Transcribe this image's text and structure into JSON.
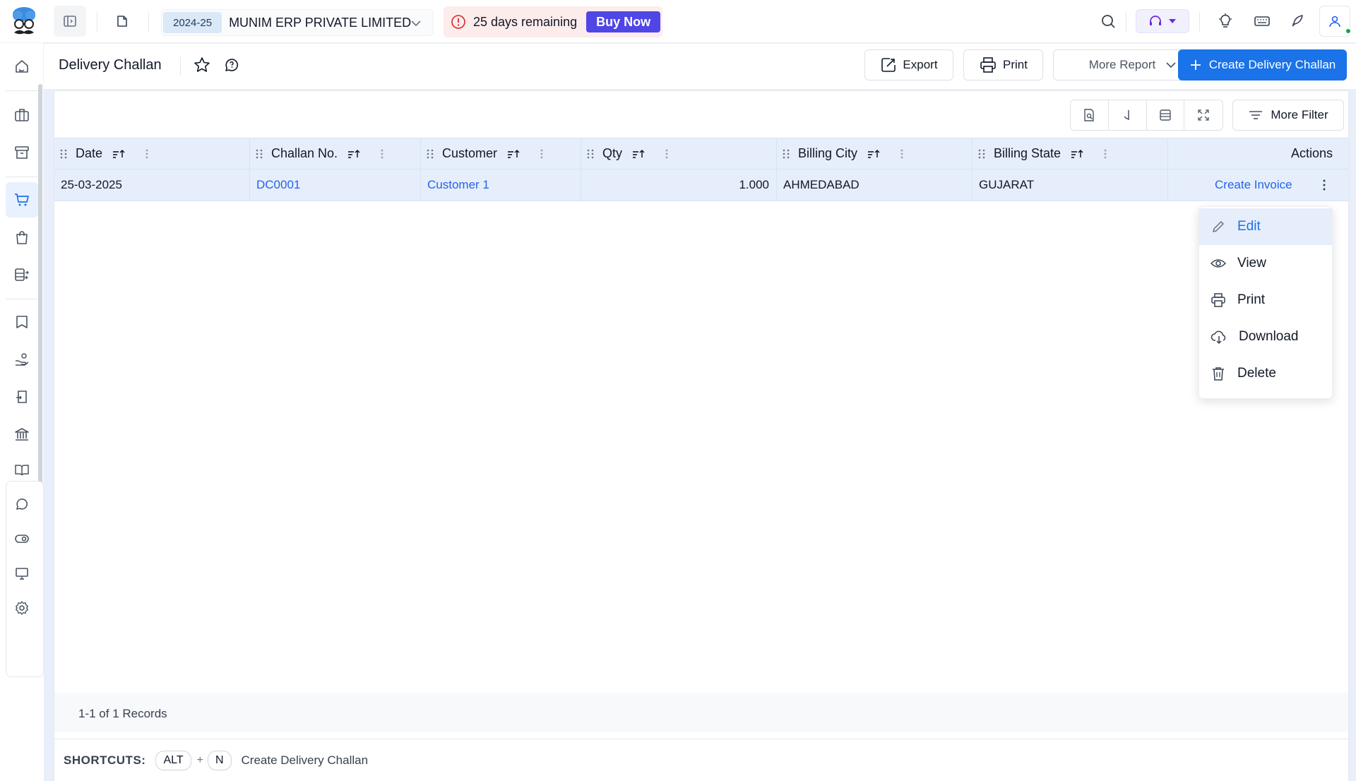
{
  "topbar": {
    "financial_year": "2024-25",
    "company_name": "MUNIM ERP PRIVATE LIMITED",
    "trial_text": "25 days remaining",
    "buy_label": "Buy Now"
  },
  "page": {
    "title": "Delivery Challan",
    "export_label": "Export",
    "print_label": "Print",
    "more_report_label": "More Report",
    "create_label": "Create Delivery Challan",
    "more_filter_label": "More Filter"
  },
  "table": {
    "columns": [
      "Date",
      "Challan No.",
      "Customer",
      "Qty",
      "Billing City",
      "Billing State"
    ],
    "actions_header": "Actions",
    "rows": [
      {
        "date": "25-03-2025",
        "challan_no": "DC0001",
        "customer": "Customer 1",
        "qty": "1.000",
        "billing_city": "AHMEDABAD",
        "billing_state": "GUJARAT",
        "action": "Create Invoice"
      }
    ]
  },
  "row_menu": {
    "items": [
      "Edit",
      "View",
      "Print",
      "Download",
      "Delete"
    ]
  },
  "footer": {
    "records": "1-1 of 1 Records"
  },
  "shortcuts": {
    "label": "SHORTCUTS:",
    "key1": "ALT",
    "plus": "+",
    "key2": "N",
    "description": "Create Delivery Challan"
  },
  "colors": {
    "primary": "#1a73e8",
    "buy_button": "#4f46e5",
    "link": "#2563eb",
    "header_bg": "#e6eefb",
    "trial_bg": "#fdecec"
  }
}
